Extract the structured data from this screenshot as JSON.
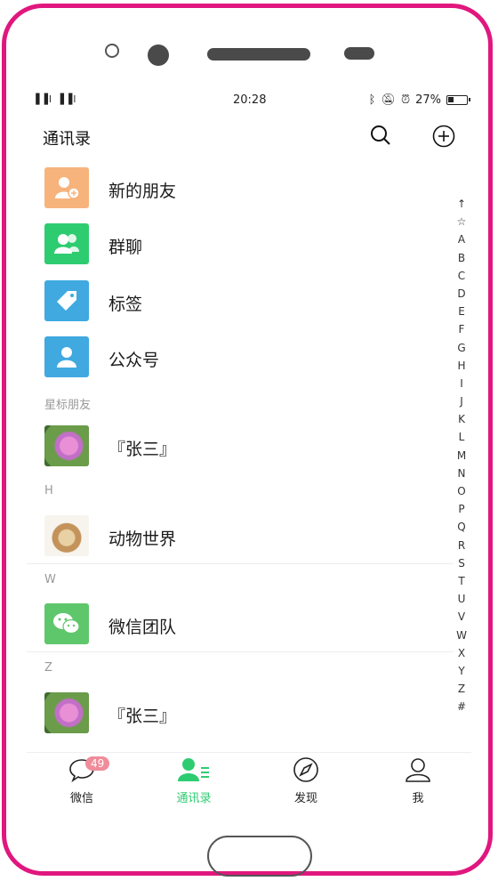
{
  "status": {
    "signal": "▐▐l ▐▐l",
    "time": "20:28",
    "battery": "27%"
  },
  "header": {
    "title": "通讯录"
  },
  "special_items": [
    {
      "label": "新的朋友",
      "color": "#f7b37c",
      "icon": "add-friend-icon"
    },
    {
      "label": "群聊",
      "color": "#2ecc71",
      "icon": "group-chat-icon"
    },
    {
      "label": "标签",
      "color": "#3fa9e0",
      "icon": "tag-icon"
    },
    {
      "label": "公众号",
      "color": "#3fa9e0",
      "icon": "official-account-icon"
    }
  ],
  "sections": [
    {
      "header": "星标朋友",
      "contacts": [
        {
          "name": "『张三』",
          "avatar": "flower"
        }
      ]
    },
    {
      "header": "H",
      "contacts": [
        {
          "name": "动物世界",
          "avatar": "lion"
        }
      ]
    },
    {
      "header": "W",
      "contacts": [
        {
          "name": "微信团队",
          "avatar": "wechat"
        }
      ]
    },
    {
      "header": "Z",
      "contacts": [
        {
          "name": "『张三』",
          "avatar": "flower"
        }
      ]
    }
  ],
  "index_bar": [
    "↑",
    "☆",
    "A",
    "B",
    "C",
    "D",
    "E",
    "F",
    "G",
    "H",
    "I",
    "J",
    "K",
    "L",
    "M",
    "N",
    "O",
    "P",
    "Q",
    "R",
    "S",
    "T",
    "U",
    "V",
    "W",
    "X",
    "Y",
    "Z",
    "#"
  ],
  "tabs": [
    {
      "label": "微信",
      "badge": "49",
      "active": false
    },
    {
      "label": "通讯录",
      "active": true
    },
    {
      "label": "发现",
      "active": false
    },
    {
      "label": "我",
      "active": false
    }
  ],
  "colors": {
    "accent": "#2ecc71",
    "frame": "#e0177e",
    "badge": "#f08c9a"
  }
}
